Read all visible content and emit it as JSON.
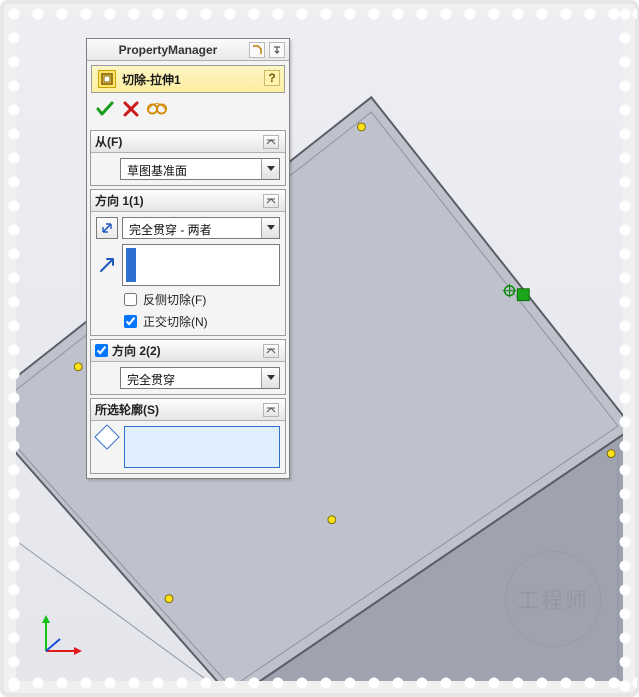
{
  "header": {
    "title": "PropertyManager"
  },
  "feature": {
    "title": "切除-拉伸1"
  },
  "groups": {
    "from": {
      "label": "从(F)",
      "selected": "草图基准面"
    },
    "dir1": {
      "label": "方向 1(1)",
      "end_condition": "完全贯穿 - 两者",
      "opt_flip_side": "反侧切除(F)",
      "opt_flip_side_checked": false,
      "opt_normal_cut": "正交切除(N)",
      "opt_normal_cut_checked": true
    },
    "dir2": {
      "label": "方向 2(2)",
      "enabled": true,
      "end_condition": "完全贯穿"
    },
    "profiles": {
      "label": "所选轮廓(S)"
    }
  },
  "watermark": "工程师"
}
